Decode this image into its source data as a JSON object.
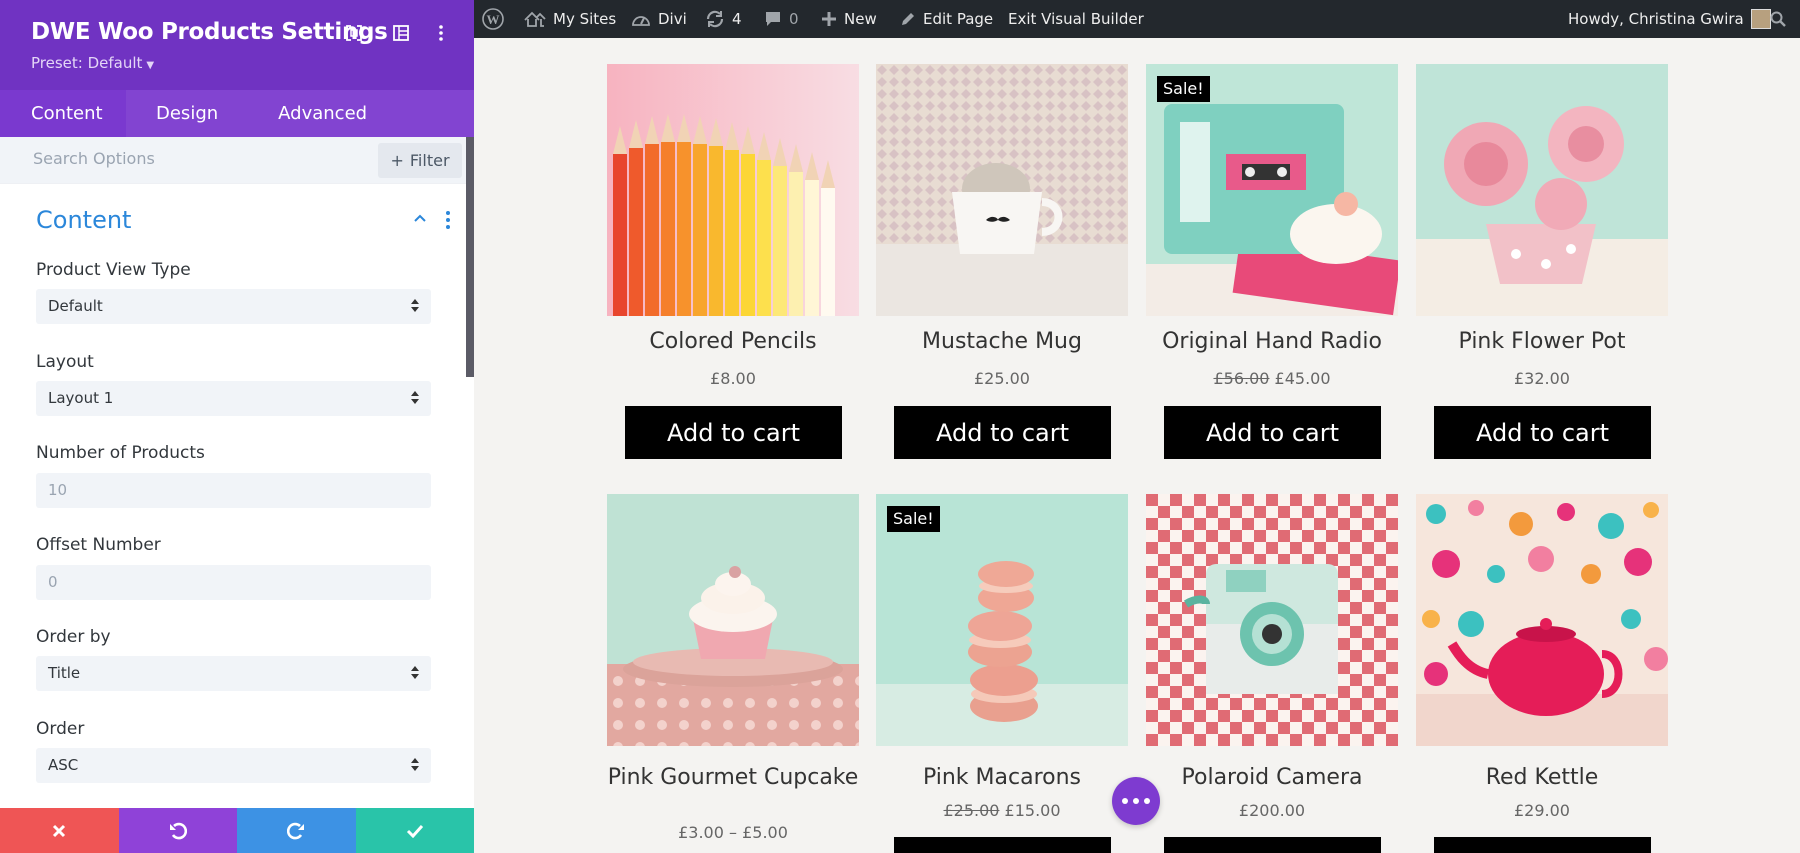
{
  "panel": {
    "title": "DWE Woo Products Settings",
    "preset": "Preset: Default",
    "tabs": [
      {
        "label": "Content"
      },
      {
        "label": "Design"
      },
      {
        "label": "Advanced"
      }
    ],
    "search_placeholder": "Search Options",
    "filter_label": "Filter",
    "section_title": "Content",
    "fields": [
      {
        "label": "Product View Type",
        "value": "Default"
      },
      {
        "label": "Layout",
        "value": "Layout 1"
      },
      {
        "label": "Number of Products",
        "value": "10"
      },
      {
        "label": "Offset Number",
        "value": "0"
      },
      {
        "label": "Order by",
        "value": "Title"
      },
      {
        "label": "Order",
        "value": "ASC"
      }
    ]
  },
  "adminbar": {
    "my_sites": "My Sites",
    "divi": "Divi",
    "updates_count": "4",
    "comments_count": "0",
    "new": "New",
    "edit_page": "Edit Page",
    "exit_builder": "Exit Visual Builder",
    "howdy": "Howdy, Christina Gwira"
  },
  "products": [
    {
      "name": "Colored Pencils",
      "price": "£8.00",
      "old_price": "",
      "sale": "",
      "cart": "Add to cart"
    },
    {
      "name": "Mustache Mug",
      "price": "£25.00",
      "old_price": "",
      "sale": "",
      "cart": "Add to cart"
    },
    {
      "name": "Original Hand Radio",
      "price": "£45.00",
      "old_price": "£56.00",
      "sale": "Sale!",
      "cart": "Add to cart"
    },
    {
      "name": "Pink Flower Pot",
      "price": "£32.00",
      "old_price": "",
      "sale": "",
      "cart": "Add to cart"
    },
    {
      "name": "Pink Gourmet Cupcake",
      "price": "£3.00 – £5.00",
      "old_price": "",
      "sale": "",
      "cart": ""
    },
    {
      "name": "Pink Macarons",
      "price": "£15.00",
      "old_price": "£25.00",
      "sale": "Sale!",
      "cart": ""
    },
    {
      "name": "Polaroid Camera",
      "price": "£200.00",
      "old_price": "",
      "sale": "",
      "cart": ""
    },
    {
      "name": "Red Kettle",
      "price": "£29.00",
      "old_price": "",
      "sale": "",
      "cart": ""
    }
  ],
  "colors": {
    "panel_purple": "#7033c2",
    "tabs_purple": "#8244d1",
    "accent_blue": "#2b87da",
    "cancel_red": "#ef5555",
    "undo_purple": "#8f42d8",
    "redo_blue": "#3d92e4",
    "save_green": "#29c4a9",
    "adminbar_dark": "#23282d"
  }
}
